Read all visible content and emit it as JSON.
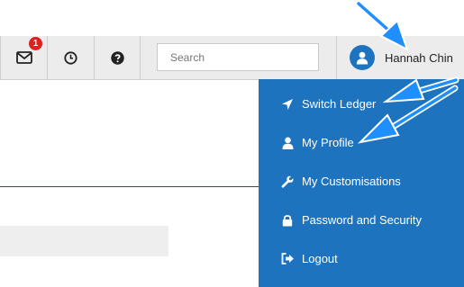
{
  "header": {
    "notifications": {
      "icon": "envelope-icon",
      "count": "1"
    },
    "history_icon": "clock-icon",
    "help_icon": "question-circle-icon",
    "search": {
      "placeholder": "Search",
      "value": ""
    },
    "user": {
      "name": "Hannah Chin",
      "icon": "user-avatar-icon"
    }
  },
  "user_menu": {
    "items": [
      {
        "label": "Switch Ledger",
        "icon": "location-arrow-icon"
      },
      {
        "label": "My Profile",
        "icon": "user-icon"
      },
      {
        "label": "My Customisations",
        "icon": "wrench-icon"
      },
      {
        "label": "Password and Security",
        "icon": "lock-icon"
      },
      {
        "label": "Logout",
        "icon": "sign-out-icon"
      }
    ]
  },
  "colors": {
    "menu_bg": "#1e73be",
    "topbar_bg": "#ececec",
    "badge": "#e02020",
    "annotation_arrow": "#1f8fff"
  }
}
